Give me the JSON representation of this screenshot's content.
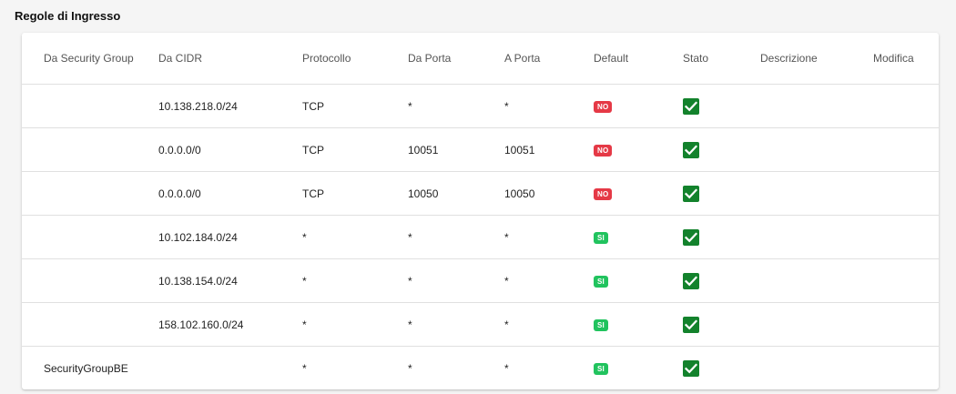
{
  "section": {
    "title": "Regole di Ingresso"
  },
  "table": {
    "headers": {
      "security_group": "Da Security Group",
      "cidr": "Da CIDR",
      "protocol": "Protocollo",
      "from_port": "Da Porta",
      "to_port": "A Porta",
      "default": "Default",
      "status": "Stato",
      "description": "Descrizione",
      "edit": "Modifica"
    },
    "rows": [
      {
        "security_group": "",
        "cidr": "10.138.218.0/24",
        "protocol": "TCP",
        "from_port": "*",
        "to_port": "*",
        "default": "NO",
        "status": "checked",
        "description": ""
      },
      {
        "security_group": "",
        "cidr": "0.0.0.0/0",
        "protocol": "TCP",
        "from_port": "10051",
        "to_port": "10051",
        "default": "NO",
        "status": "checked",
        "description": ""
      },
      {
        "security_group": "",
        "cidr": "0.0.0.0/0",
        "protocol": "TCP",
        "from_port": "10050",
        "to_port": "10050",
        "default": "NO",
        "status": "checked",
        "description": ""
      },
      {
        "security_group": "",
        "cidr": "10.102.184.0/24",
        "protocol": "*",
        "from_port": "*",
        "to_port": "*",
        "default": "SI",
        "status": "checked",
        "description": ""
      },
      {
        "security_group": "",
        "cidr": "10.138.154.0/24",
        "protocol": "*",
        "from_port": "*",
        "to_port": "*",
        "default": "SI",
        "status": "checked",
        "description": ""
      },
      {
        "security_group": "",
        "cidr": "158.102.160.0/24",
        "protocol": "*",
        "from_port": "*",
        "to_port": "*",
        "default": "SI",
        "status": "checked",
        "description": ""
      },
      {
        "security_group": "SecurityGroupBE",
        "cidr": "",
        "protocol": "*",
        "from_port": "*",
        "to_port": "*",
        "default": "SI",
        "status": "checked",
        "description": ""
      }
    ]
  },
  "colors": {
    "badge_no": "#e53946",
    "badge_si": "#21c35e",
    "check": "#13822c"
  },
  "icons": {
    "status": "checkbox-checked-icon"
  }
}
